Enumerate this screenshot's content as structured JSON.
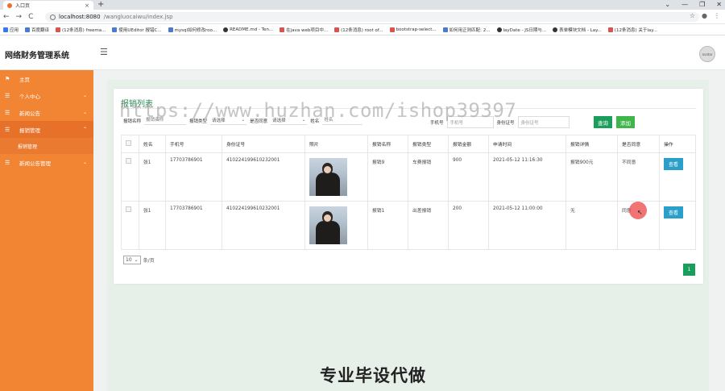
{
  "browser": {
    "tab_title": "入口页",
    "tab_close": "×",
    "new_tab": "+",
    "window_controls": [
      "⌄",
      "—",
      "❐",
      "✕"
    ],
    "nav": [
      "←",
      "→",
      "C"
    ],
    "url_host": "localhost:8080",
    "url_path": "/wangluocaiwu/index.jsp",
    "addr_icons": [
      "☆",
      "●",
      "⋮"
    ],
    "bookmarks": [
      {
        "label": "应用",
        "icon": "grid-icon"
      },
      {
        "label": "百度翻译",
        "icon": "translate-icon"
      },
      {
        "label": "(12条消息) freema...",
        "icon": "csdn-icon"
      },
      {
        "label": "使用UEditor 报错C...",
        "icon": "paw-icon"
      },
      {
        "label": "mysql如何修改roo...",
        "icon": "paw-icon"
      },
      {
        "label": "README.md - Ten...",
        "icon": "github-icon"
      },
      {
        "label": "在java web项目中...",
        "icon": "csdn-icon"
      },
      {
        "label": "(12条消息) root of...",
        "icon": "csdn-icon"
      },
      {
        "label": "bootstrap-select...",
        "icon": "doc-icon"
      },
      {
        "label": "如何用正则匹配: 2...",
        "icon": "q-icon"
      },
      {
        "label": "layDate - JS日期与...",
        "icon": "layui-icon"
      },
      {
        "label": "表单模块文档 - Lay...",
        "icon": "layui-icon"
      },
      {
        "label": "(12条消息) 关于lay...",
        "icon": "csdn-icon"
      }
    ]
  },
  "header": {
    "title": "网络财务管理系统",
    "menu_icon": "☰",
    "avatar_text": "avatar"
  },
  "sidebar": {
    "items": [
      {
        "label": "主页",
        "icon": "⚑",
        "chevron": ""
      },
      {
        "label": "个人中心",
        "icon": "☰",
        "chevron": "⌄"
      },
      {
        "label": "新闻公告",
        "icon": "☰",
        "chevron": "⌄"
      },
      {
        "label": "报销管理",
        "icon": "☰",
        "chevron": "⌃"
      },
      {
        "label": "新闻公告管理",
        "icon": "☰",
        "chevron": "⌄"
      }
    ],
    "active_sub": "报销管理"
  },
  "content": {
    "title": "报销列表",
    "filters": {
      "name_label": "报销名称",
      "name_placeholder": "报销名称",
      "type_label": "报销类型",
      "type_value": "请选择",
      "agree_label": "是否同意",
      "agree_value": "请选择",
      "person_label": "姓名",
      "person_placeholder": "姓名",
      "phone_label": "手机号",
      "phone_placeholder": "手机号",
      "idcard_label": "身份证号",
      "idcard_placeholder": "身份证号",
      "dropdown_arrow": "⌄"
    },
    "buttons": {
      "search": "查询",
      "add": "添加"
    },
    "table": {
      "headers": [
        "",
        "姓名",
        "手机号",
        "身份证号",
        "照片",
        "报销名称",
        "报销类型",
        "报销金额",
        "申请时间",
        "报销详情",
        "是否同意",
        "操作"
      ],
      "rows": [
        {
          "name": "张1",
          "phone": "17703786901",
          "idcard": "410224199610232001",
          "reimb_name": "报销9",
          "type": "车费报销",
          "amount": "900",
          "time": "2021-05-12 11:16:30",
          "detail": "报销900元",
          "agree": "不同意",
          "action": "查看"
        },
        {
          "name": "张1",
          "phone": "17703786901",
          "idcard": "410224199610232001",
          "reimb_name": "报销1",
          "type": "出差报销",
          "amount": "200",
          "time": "2021-05-12 11:00:00",
          "detail": "无",
          "agree": "同意",
          "action": "查看"
        }
      ]
    },
    "pager": {
      "page_size": "10",
      "size_suffix": "条/页",
      "current_page": "1"
    }
  },
  "overlay": {
    "watermark": "https://www.huzhan.com/ishop39397",
    "promo": "专业毕设代做"
  },
  "colors": {
    "sidebar": "#f28534",
    "accent_green": "#1a9e5b",
    "view_button": "#2a9fc9"
  }
}
